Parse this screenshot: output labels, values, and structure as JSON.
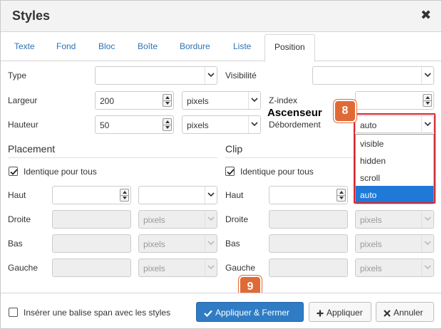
{
  "dialog": {
    "title": "Styles",
    "close_glyph": "✖"
  },
  "tabs": [
    {
      "label": "Texte"
    },
    {
      "label": "Fond"
    },
    {
      "label": "Bloc"
    },
    {
      "label": "Boîte"
    },
    {
      "label": "Bordure"
    },
    {
      "label": "Liste"
    },
    {
      "label": "Position",
      "active": true
    }
  ],
  "left": {
    "type_label": "Type",
    "type_value": "",
    "width_label": "Largeur",
    "width_value": "200",
    "width_unit": "pixels",
    "height_label": "Hauteur",
    "height_value": "50",
    "height_unit": "pixels"
  },
  "right": {
    "visibility_label": "Visibilité",
    "visibility_value": "",
    "zindex_label": "Z-index",
    "zindex_value": "",
    "overflow_label": "Débordement",
    "overflow_value": "auto",
    "overflow_options": [
      "visible",
      "hidden",
      "scroll",
      "auto"
    ],
    "overflow_selected": "auto"
  },
  "placement": {
    "title": "Placement",
    "same_for_all": "Identique pour tous",
    "same_checked": true,
    "top_label": "Haut",
    "right_label": "Droite",
    "bottom_label": "Bas",
    "left_label": "Gauche",
    "unit_disabled": "pixels"
  },
  "clip": {
    "title": "Clip",
    "same_for_all": "Identique pour tous",
    "same_checked": true,
    "top_label": "Haut",
    "right_label": "Droite",
    "bottom_label": "Bas",
    "left_label": "Gauche",
    "unit_disabled": "pixels"
  },
  "annotations": {
    "badge_8": "8",
    "callout_8": "Ascenseur",
    "badge_9": "9"
  },
  "footer": {
    "span_checkbox_label": "Insérer une balise span avec les styles",
    "span_checked": false,
    "apply_close": "Appliquer & Fermer",
    "apply": "Appliquer",
    "cancel": "Annuler"
  },
  "colors": {
    "accent": "#2f7cc4",
    "link": "#2b73b7",
    "highlight_border": "#d9262f",
    "badge": "#e06a36",
    "selected_option": "#1e79d7"
  }
}
